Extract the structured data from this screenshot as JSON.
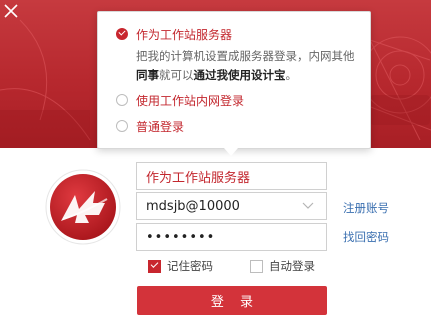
{
  "popup": {
    "option_server": "作为工作站服务器",
    "option_server_checked": true,
    "desc_part1": "把我的计算机设置成服务器登录，内网其他",
    "desc_bold1": "同事",
    "desc_part2": "就可以",
    "desc_bold2": "通过我使用设计宝",
    "desc_part3": "。",
    "option_intranet": "使用工作站内网登录",
    "option_normal": "普通登录"
  },
  "form": {
    "server_mode": "作为工作站服务器",
    "account": "mdsjb@10000",
    "password_mask": "••••••••",
    "register_link": "注册账号",
    "recover_link": "找回密码",
    "remember_label": "记住密码",
    "remember_checked": true,
    "autologin_label": "自动登录",
    "autologin_checked": false,
    "login_button": "登 录"
  },
  "colors": {
    "brand_red": "#c8262e",
    "link_blue": "#3a6fb0"
  },
  "icons": {
    "close": "close-icon",
    "logo": "app-logo",
    "chevron": "chevron-down-icon"
  }
}
